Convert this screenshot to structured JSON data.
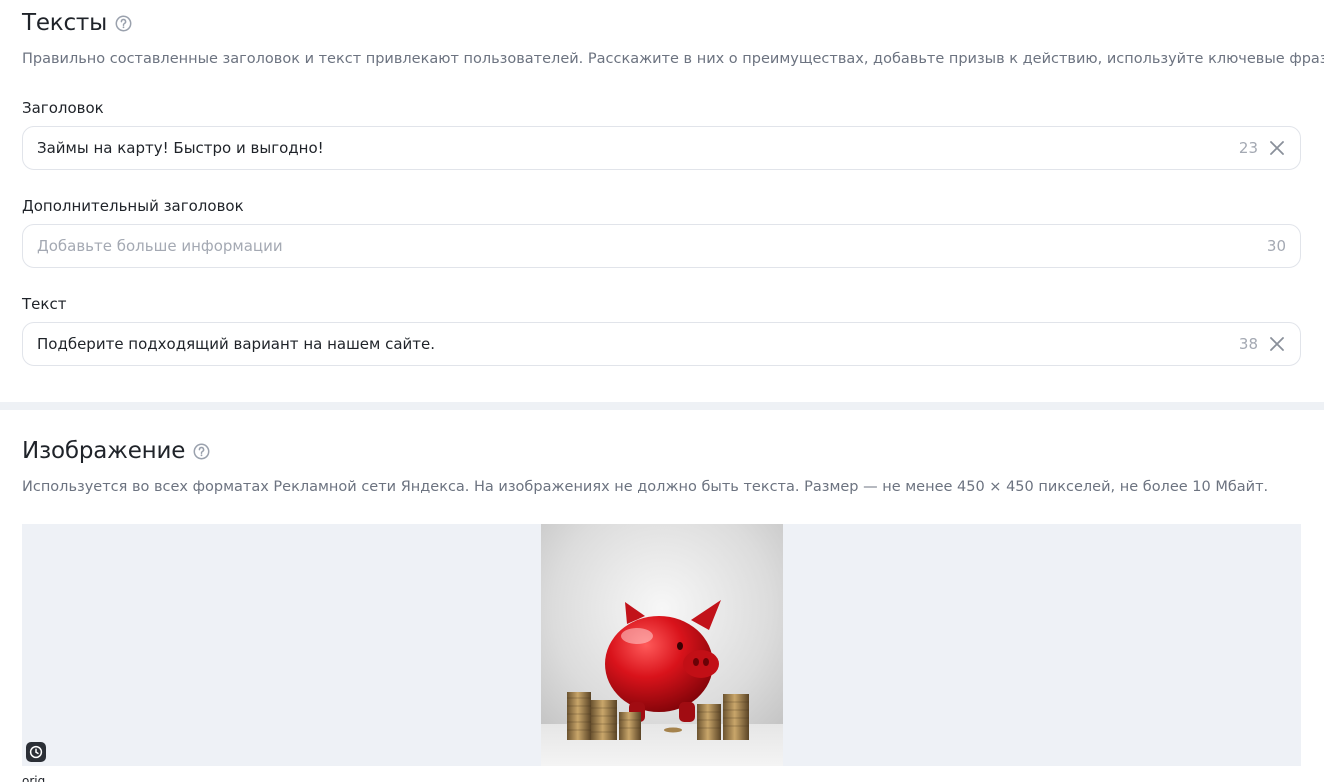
{
  "texts_section": {
    "title": "Тексты",
    "help_icon": "question-circle-icon",
    "description": "Правильно составленные заголовок и текст привлекают пользователей. Расскажите в них о преимуществах, добавьте призыв к действию, используйте ключевые фразы.",
    "headline": {
      "label": "Заголовок",
      "value": "Займы на карту! Быстро и выгодно!",
      "counter": "23",
      "clear_icon": "close-icon"
    },
    "extra_headline": {
      "label": "Дополнительный заголовок",
      "placeholder": "Добавьте больше информации",
      "counter": "30"
    },
    "text": {
      "label": "Текст",
      "value": "Подберите подходящий вариант на нашем сайте.",
      "counter": "38",
      "clear_icon": "close-icon"
    }
  },
  "image_section": {
    "title": "Изображение",
    "help_icon": "question-circle-icon",
    "description": "Используется во всех форматах Рекламной сети Яндекса. На изображениях не должно быть текста. Размер — не менее 450 × 450 пикселей, не более 10 Мбайт.",
    "preview_alt": "red-piggy-bank-with-coins",
    "history_icon": "clock-icon",
    "caption": "orig"
  },
  "colors": {
    "text_primary": "#1f2329",
    "text_secondary": "#6c7380",
    "placeholder": "#a4a9b3",
    "field_border": "#e1e4ea",
    "image_bg": "#eef1f6",
    "divider": "#eef1f5"
  }
}
